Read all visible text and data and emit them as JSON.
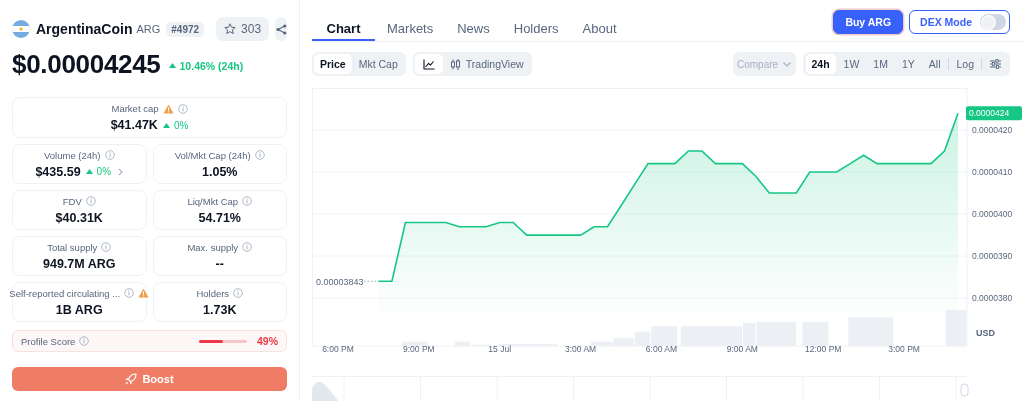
{
  "coin": {
    "name": "ArgentinaCoin",
    "symbol": "ARG",
    "rank": "#4972",
    "watchlist_count": "303"
  },
  "price": {
    "value": "$0.00004245",
    "change": "10.46% (24h)"
  },
  "stats": [
    {
      "kind": "wide",
      "label": "Market cap",
      "value": "$41.47K",
      "change": "0%",
      "warning": true,
      "expandable": false
    },
    {
      "kind": "half",
      "label": "Volume (24h)",
      "value": "$435.59",
      "change": "0%",
      "warning": false,
      "expandable": true
    },
    {
      "kind": "half",
      "label": "Vol/Mkt Cap (24h)",
      "value": "1.05%",
      "warning": false,
      "expandable": false
    },
    {
      "kind": "half",
      "label": "FDV",
      "value": "$40.31K",
      "warning": false,
      "expandable": false
    },
    {
      "kind": "half",
      "label": "Liq/Mkt Cap",
      "value": "54.71%",
      "warning": false,
      "expandable": false
    },
    {
      "kind": "half",
      "label": "Total supply",
      "value": "949.7M ARG",
      "warning": false,
      "expandable": false
    },
    {
      "kind": "half",
      "label": "Max. supply",
      "value": "--",
      "warning": false,
      "expandable": false
    },
    {
      "kind": "half",
      "label": "Self-reported circulating ...",
      "value": "1B ARG",
      "warning": true,
      "expandable": false
    },
    {
      "kind": "half",
      "label": "Holders",
      "value": "1.73K",
      "warning": false,
      "expandable": false
    }
  ],
  "profile_score": {
    "label": "Profile Score",
    "level": 0.49,
    "value": "49%"
  },
  "boost_button": "Boost",
  "tabs": [
    {
      "label": "Chart",
      "selected": true
    },
    {
      "label": "Markets",
      "selected": false
    },
    {
      "label": "News",
      "selected": false
    },
    {
      "label": "Holders",
      "selected": false
    },
    {
      "label": "About",
      "selected": false
    }
  ],
  "buy_button": "Buy ARG",
  "dex_mode": {
    "label": "DEX Mode",
    "on": false
  },
  "chart_toolbar": {
    "metrics": [
      {
        "label": "Price",
        "selected": true
      },
      {
        "label": "Mkt Cap",
        "selected": false
      }
    ],
    "chart_types": [
      {
        "kind": "line",
        "selected": true
      },
      {
        "kind": "candles",
        "label": "TradingView",
        "selected": false
      }
    ],
    "compare": {
      "label": "Compare",
      "disabled": true
    },
    "ranges": [
      {
        "label": "24h",
        "selected": true
      },
      {
        "label": "1W",
        "selected": false
      },
      {
        "label": "1M",
        "selected": false
      },
      {
        "label": "1Y",
        "selected": false
      },
      {
        "label": "All",
        "selected": false
      }
    ],
    "log": {
      "label": "Log",
      "on": false
    }
  },
  "chart": {
    "open_price_label": "0.00003843",
    "current_price_label": "0.0000424",
    "currency": "USD",
    "chart_data": {
      "type": "area",
      "grid": true,
      "categories": [
        null,
        null,
        "6:00 PM",
        null,
        null,
        null,
        null,
        null,
        "9:00 PM",
        null,
        null,
        null,
        null,
        null,
        "15 Jul",
        null,
        null,
        null,
        null,
        null,
        "3:00 AM",
        null,
        null,
        null,
        null,
        null,
        "6:00 AM",
        null,
        null,
        null,
        null,
        null,
        "9:00 AM",
        null,
        null,
        null,
        null,
        null,
        "12:00 PM",
        null,
        null,
        null,
        null,
        null,
        "3:00 PM",
        null,
        null,
        null,
        null
      ],
      "series": [
        {
          "color": "#16c784",
          "values": [
            null,
            null,
            null,
            null,
            null,
            3.84e-05,
            3.84e-05,
            3.98e-05,
            3.98e-05,
            3.98e-05,
            3.98e-05,
            3.97e-05,
            3.97e-05,
            3.97e-05,
            3.98e-05,
            3.98e-05,
            3.95e-05,
            3.95e-05,
            3.95e-05,
            3.95e-05,
            3.95e-05,
            3.97e-05,
            3.97e-05,
            4.02e-05,
            4.07e-05,
            4.12e-05,
            4.12e-05,
            4.12e-05,
            4.15e-05,
            4.15e-05,
            4.12e-05,
            4.12e-05,
            4.12e-05,
            4.09e-05,
            4.05e-05,
            4.05e-05,
            4.05e-05,
            4.1e-05,
            4.1e-05,
            4.1e-05,
            4.12e-05,
            4.14e-05,
            4.12e-05,
            4.12e-05,
            4.12e-05,
            4.12e-05,
            4.12e-05,
            4.15e-05,
            4.24e-05
          ]
        }
      ],
      "ylim": [
        3.686e-05,
        4.3e-05
      ],
      "yticks": [
        {
          "value": 4.2e-05,
          "label": "0.0000420"
        },
        {
          "value": 4.1e-05,
          "label": "0.0000410"
        },
        {
          "value": 4e-05,
          "label": "0.0000400"
        },
        {
          "value": 3.9e-05,
          "label": "0.0000390"
        },
        {
          "value": 3.8e-05,
          "label": "0.0000380"
        }
      ]
    }
  }
}
